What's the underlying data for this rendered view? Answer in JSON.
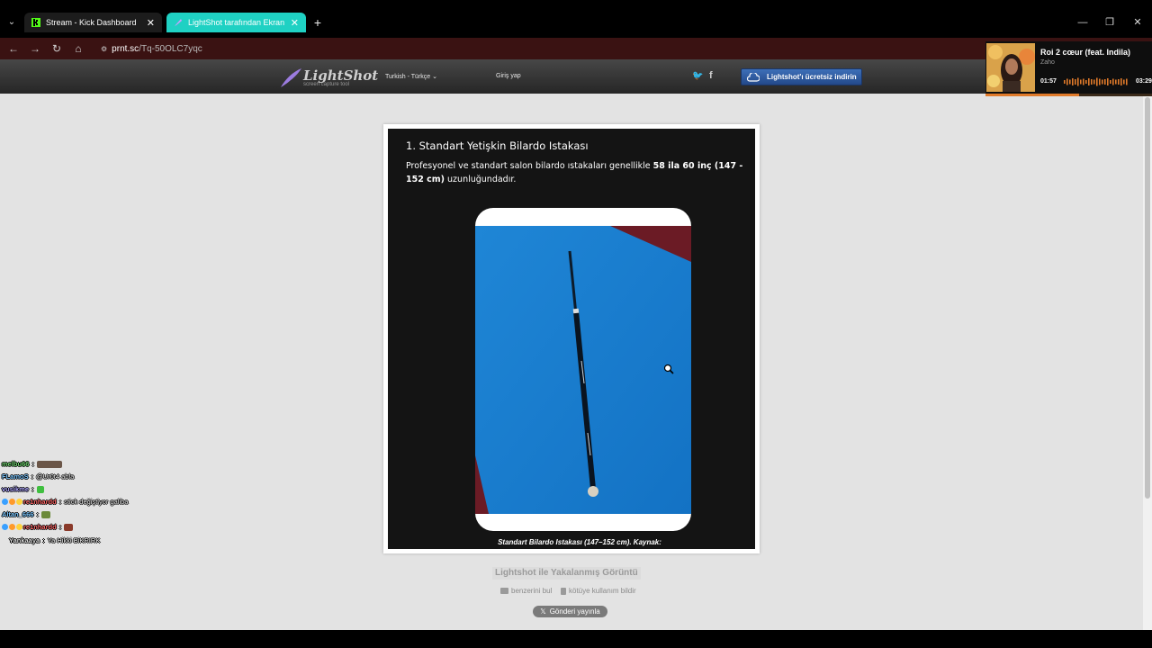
{
  "browser": {
    "tabs": [
      {
        "label": "Stream - Kick Dashboard",
        "favicon": "kick-icon",
        "active": false
      },
      {
        "label": "LightShot tarafından Ekran Görü",
        "favicon": "lightshot-feather-icon",
        "active": true
      }
    ],
    "url_host": "prnt.sc",
    "url_path": "/Tq-50OLC7yqc",
    "accent_color": "#1fd1c3"
  },
  "site": {
    "logo_title": "LightShot",
    "logo_subtitle": "screen capture tool",
    "language": "Turkish - Türkçe",
    "login": "Giriş yap",
    "download_button": "Lightshot'ı ücretsiz indirin"
  },
  "screenshot": {
    "title": "1. Standart Yetişkin Bilardo Istakası",
    "body_pre": "Profesyonel ve standart salon bilardo ıstakaları genellikle ",
    "body_bold": "58 ila 60 inç (147 - 152 cm)",
    "body_post": " uzunluğundadır.",
    "caption": "Standart Bilardo Istakası (147–152 cm). Kaynak:"
  },
  "below": {
    "captured_with": "Lightshot ile Yakalanmış Görüntü",
    "find_similar": "benzerini bul",
    "report_abuse": "kötüye kullanım bildir",
    "tweet": "Gönderi yayınla"
  },
  "chat": [
    {
      "user": "melbu66",
      "color": "#6fd36f",
      "text": "",
      "emote": true
    },
    {
      "user": "FLamoS",
      "color": "#7ec8ff",
      "text": "@Ur0t4 abla",
      "emote": false
    },
    {
      "user": "vusikme",
      "color": "#b0a8ff",
      "text": "",
      "emote": true
    },
    {
      "user": "re1nhardd",
      "color": "#ff6b6b",
      "text": "stick değiştiyor galiba",
      "emote": false
    },
    {
      "user": "Altan_666",
      "color": "#7ec8ff",
      "text": "",
      "emote": true
    },
    {
      "user": "re1nhardd",
      "color": "#ff6b6b",
      "text": "",
      "emote": true
    },
    {
      "user": "Yankaaya",
      "color": "#dddddd",
      "text": "Ya Hikki BiKRIRK",
      "emote": false
    }
  ],
  "music": {
    "song": "Roi 2 cœur (feat. Indila)",
    "artist": "Zaho",
    "current_time": "01:57",
    "total_time": "03:29",
    "progress": 0.56
  }
}
